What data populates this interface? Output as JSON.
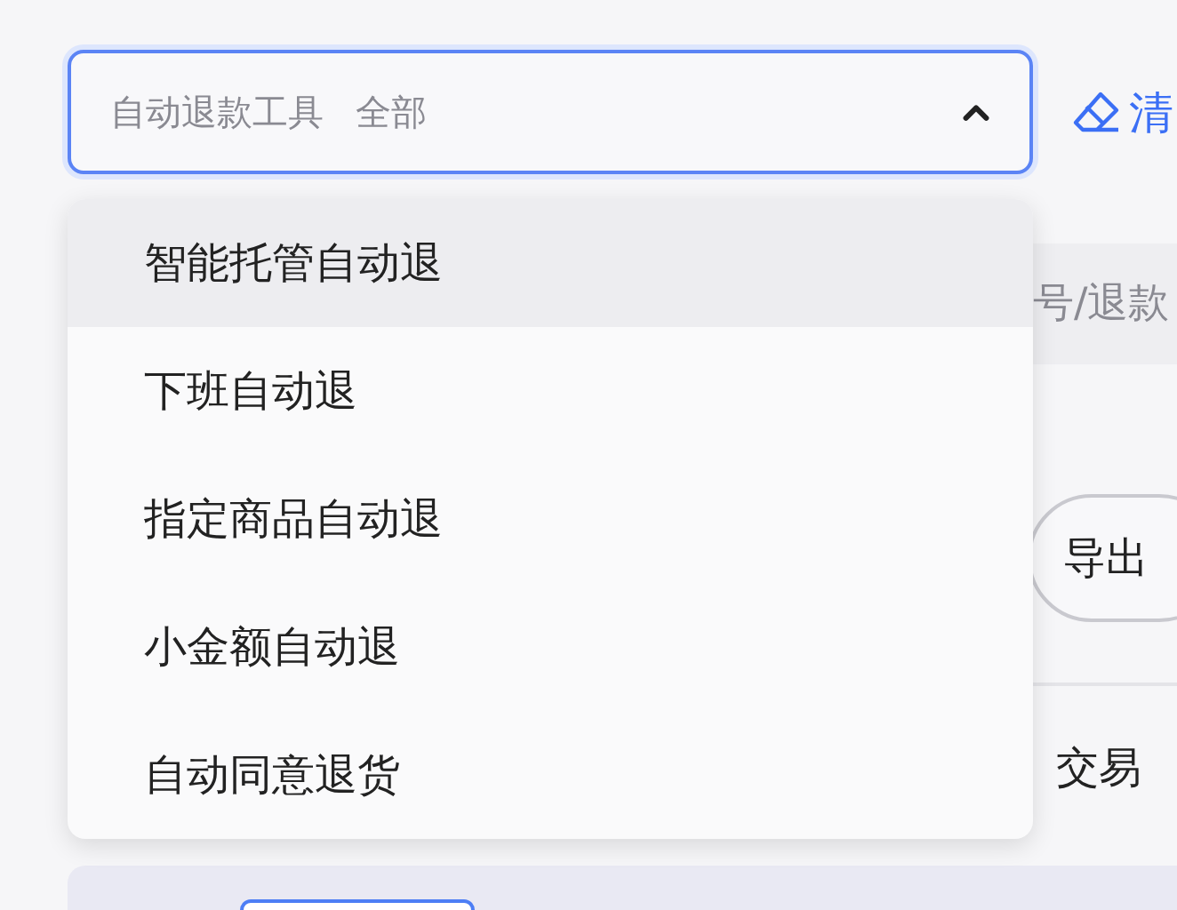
{
  "select": {
    "label": "自动退款工具",
    "value": "全部",
    "expanded": true
  },
  "clear_button": {
    "label": "清"
  },
  "search_field": {
    "placeholder": "号/退款"
  },
  "export_button": {
    "label": "导出"
  },
  "column_header": "交易",
  "dropdown": {
    "options": [
      {
        "label": "智能托管自动退",
        "selected": true
      },
      {
        "label": "下班自动退",
        "selected": false
      },
      {
        "label": "指定商品自动退",
        "selected": false
      },
      {
        "label": "小金额自动退",
        "selected": false
      },
      {
        "label": "自动同意退货",
        "selected": false
      }
    ]
  }
}
